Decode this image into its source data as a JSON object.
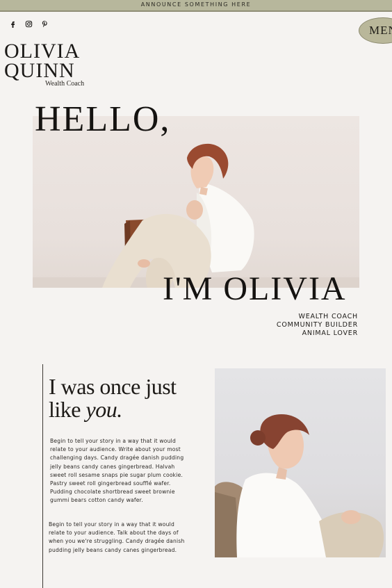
{
  "announcement": "ANNOUNCE SOMETHING HERE",
  "social_icons": [
    "facebook-icon",
    "instagram-icon",
    "pinterest-icon"
  ],
  "menu_label": "MENU",
  "logo": {
    "line1": "OLIVIA",
    "line2": "QUINN",
    "subtitle": "Wealth Coach"
  },
  "hero": {
    "hello": "HELLO,",
    "im_olivia": "I'M OLIVIA",
    "roles": [
      "WEALTH COACH",
      "COMMUNITY BUILDER",
      "ANIMAL LOVER"
    ]
  },
  "story": {
    "title_line1": "I was once just",
    "title_line2_plain": "like ",
    "title_line2_italic": "you.",
    "paragraph1": "Begin to tell your story in a way that it would relate to your audience. Write about your most challenging days. Candy dragée danish pudding jelly beans candy canes gingerbread. Halvah sweet roll sesame snaps pie sugar plum cookie. Pastry sweet roll gingerbread soufflé wafer. Pudding chocolate shortbread sweet brownie gummi bears cotton candy wafer.",
    "paragraph2": "Begin to tell your story in a way that it would relate to your audience. Talk about the days of when you we're struggling. Candy dragée danish pudding jelly beans candy canes gingerbread."
  },
  "colors": {
    "background": "#f5f3f1",
    "accent_sage": "#b7b79c",
    "text": "#1c1917"
  }
}
